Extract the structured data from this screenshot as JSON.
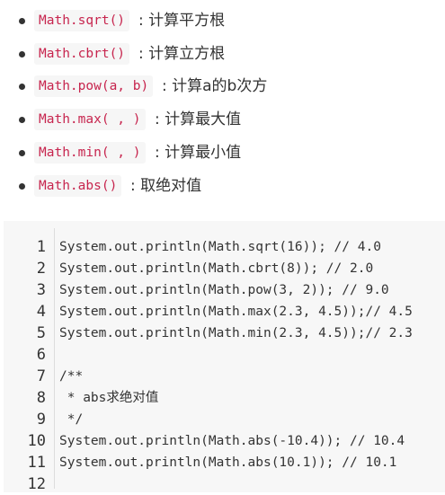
{
  "methods": [
    {
      "code": "Math.sqrt()",
      "desc": ": 计算平方根"
    },
    {
      "code": "Math.cbrt()",
      "desc": ": 计算立方根"
    },
    {
      "code": "Math.pow(a, b)",
      "desc": ": 计算a的b次方"
    },
    {
      "code": "Math.max( , )",
      "desc": ": 计算最大值"
    },
    {
      "code": "Math.min( , )",
      "desc": ": 计算最小值"
    },
    {
      "code": "Math.abs()",
      "desc": ": 取绝对值"
    }
  ],
  "code_block": {
    "line_numbers": [
      "1",
      "2",
      "3",
      "4",
      "5",
      "6",
      "7",
      "8",
      "9",
      "10",
      "11",
      "12"
    ],
    "lines": [
      "System.out.println(Math.sqrt(16)); // 4.0",
      "System.out.println(Math.cbrt(8)); // 2.0",
      "System.out.println(Math.pow(3, 2)); // 9.0",
      "System.out.println(Math.max(2.3, 4.5));// 4.5",
      "System.out.println(Math.min(2.3, 4.5));// 2.3",
      "",
      "/**",
      " * abs求绝对值",
      " */",
      "System.out.println(Math.abs(-10.4)); // 10.4",
      "System.out.println(Math.abs(10.1)); // 10.1",
      ""
    ]
  }
}
